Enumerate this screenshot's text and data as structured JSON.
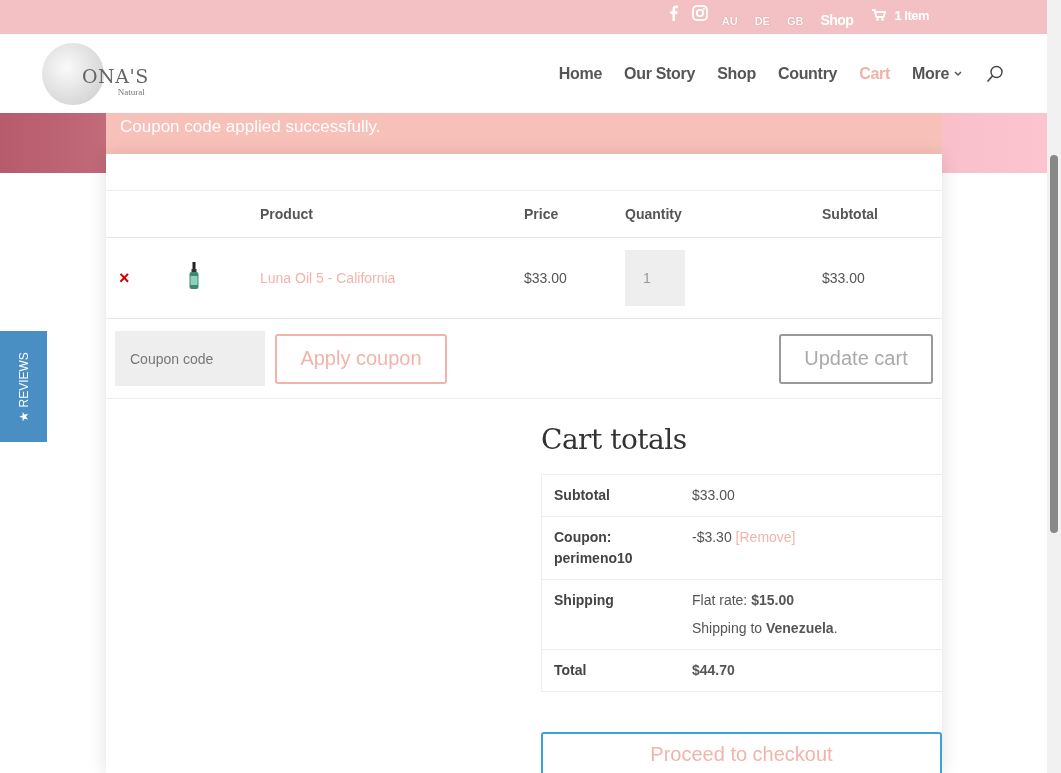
{
  "top_bar": {
    "languages": [
      "AU",
      "DE",
      "GB"
    ],
    "shop_link": "Shop",
    "cart": "1 Item"
  },
  "header": {
    "logo": {
      "title": "ONA'S",
      "subtitle": "Natural"
    },
    "nav": [
      {
        "label": "Home",
        "selected": false,
        "dropdown": false
      },
      {
        "label": "Our Story",
        "selected": false,
        "dropdown": false
      },
      {
        "label": "Shop",
        "selected": false,
        "dropdown": false
      },
      {
        "label": "Country",
        "selected": false,
        "dropdown": false
      },
      {
        "label": "Cart",
        "selected": true,
        "dropdown": false
      },
      {
        "label": "More",
        "selected": false,
        "dropdown": true
      }
    ]
  },
  "notice": "Coupon code applied successfully.",
  "cart_table": {
    "columns": [
      "Product",
      "Price",
      "Quantity",
      "Subtotal"
    ],
    "rows": [
      {
        "remove_symbol": "×",
        "product": "Luna Oil 5 - California",
        "price": "$33.00",
        "quantity": "1",
        "subtotal": "$33.00"
      }
    ]
  },
  "actions": {
    "coupon_placeholder": "Coupon code",
    "apply": "Apply coupon",
    "update": "Update cart"
  },
  "totals": {
    "title": "Cart totals",
    "rows": [
      {
        "kind": "plain",
        "label": "Subtotal",
        "value": "$33.00"
      },
      {
        "kind": "coupon",
        "label": "Coupon: perimeno10",
        "value": "-$3.30",
        "link": "[Remove]"
      },
      {
        "kind": "shipping",
        "label": "Shipping",
        "value": "Flat rate: **$15.00**",
        "note": "Shipping to **Venezuela**."
      },
      {
        "kind": "total",
        "label": "Total",
        "value": "$44.70"
      }
    ],
    "checkout": "Proceed to checkout"
  },
  "reviews_tab": "★ REVIEWS"
}
